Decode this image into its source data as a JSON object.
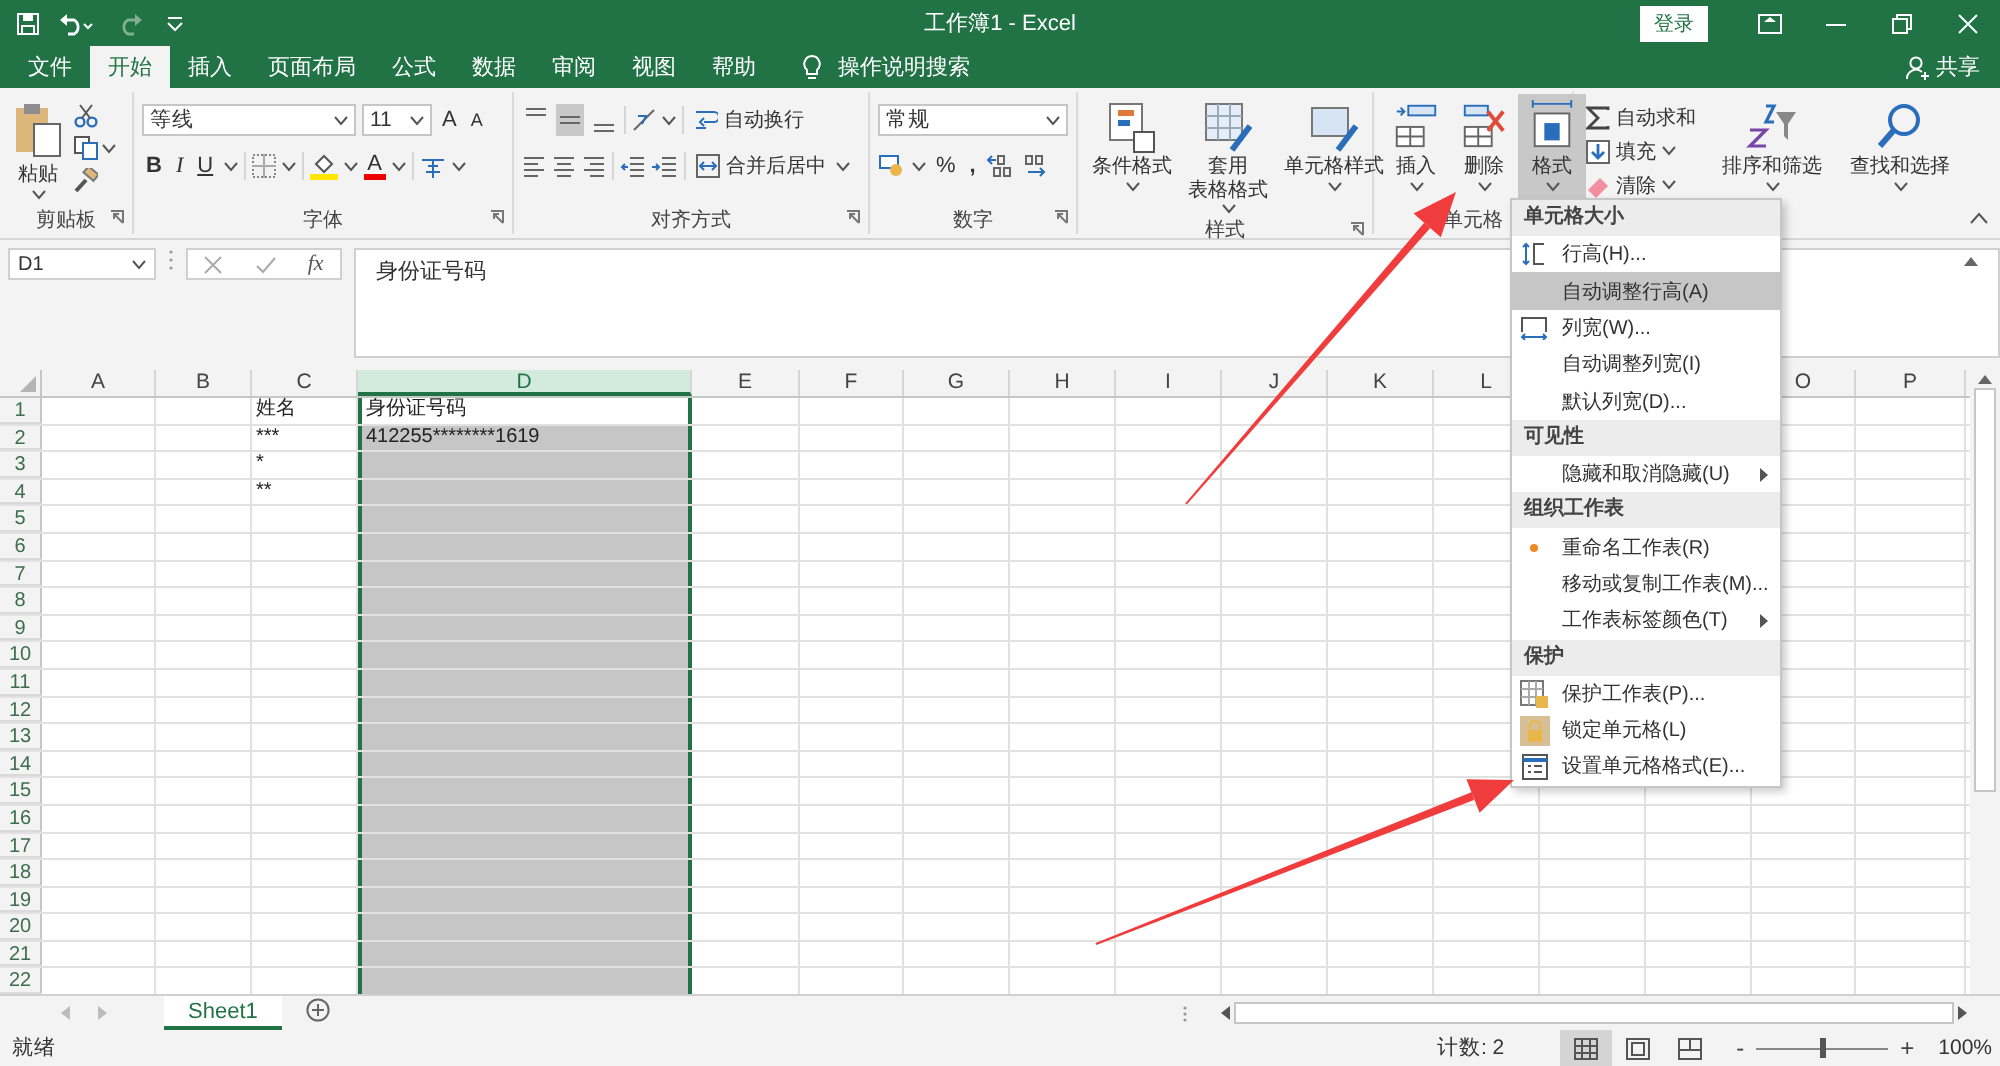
{
  "title_bar": {
    "title": "工作簿1 - Excel",
    "sign_in": "登录"
  },
  "tabs": [
    {
      "label": "文件",
      "selected": false
    },
    {
      "label": "开始",
      "selected": true
    },
    {
      "label": "插入",
      "selected": false
    },
    {
      "label": "页面布局",
      "selected": false
    },
    {
      "label": "公式",
      "selected": false
    },
    {
      "label": "数据",
      "selected": false
    },
    {
      "label": "审阅",
      "selected": false
    },
    {
      "label": "视图",
      "selected": false
    },
    {
      "label": "帮助",
      "selected": false
    }
  ],
  "tell_me": "操作说明搜索",
  "share": "共享",
  "ribbon": {
    "groups": [
      {
        "kind": "clipboard",
        "label": "剪贴板",
        "paste": "粘贴"
      },
      {
        "kind": "font",
        "label": "字体",
        "font_name": "等线",
        "font_size": "11",
        "grow": "A",
        "shrink": "A",
        "bold": "B",
        "italic": "I",
        "underline": "U",
        "font_color": "A"
      },
      {
        "kind": "alignment",
        "label": "对齐方式",
        "wrap": "自动换行",
        "merge": "合并后居中",
        "vertical": [
          {
            "selected": false
          },
          {
            "selected": true
          },
          {
            "selected": false
          }
        ]
      },
      {
        "kind": "number",
        "label": "数字",
        "format": "常规",
        "percent": "%",
        "comma": ","
      },
      {
        "kind": "styles",
        "label": "样式",
        "buttons": [
          {
            "lines": [
              "条件格式"
            ]
          },
          {
            "lines": [
              "套用",
              "表格格式"
            ]
          },
          {
            "lines": [
              "单元格样式"
            ]
          }
        ]
      },
      {
        "kind": "cells",
        "label": "单元格",
        "buttons": [
          {
            "label": "插入",
            "selected": false
          },
          {
            "label": "删除",
            "selected": false
          },
          {
            "label": "格式",
            "selected": true
          }
        ]
      },
      {
        "kind": "editing",
        "autosum": "自动求和",
        "fill": "填充",
        "clear": "清除",
        "sort": "排序和筛选",
        "find": "查找和选择"
      }
    ]
  },
  "formula_bar": {
    "name_box": "D1",
    "fx": "fx",
    "formula": "身份证号码"
  },
  "sheet": {
    "columns": [
      {
        "label": "A",
        "selected": false
      },
      {
        "label": "B",
        "selected": false
      },
      {
        "label": "C",
        "selected": false
      },
      {
        "label": "D",
        "selected": true
      },
      {
        "label": "E",
        "selected": false
      },
      {
        "label": "F",
        "selected": false
      },
      {
        "label": "G",
        "selected": false
      },
      {
        "label": "H",
        "selected": false
      },
      {
        "label": "I",
        "selected": false
      },
      {
        "label": "J",
        "selected": false
      },
      {
        "label": "K",
        "selected": false
      },
      {
        "label": "L",
        "selected": false
      },
      {
        "label": "O",
        "selected": false
      },
      {
        "label": "P",
        "selected": false
      }
    ],
    "rows": [
      {
        "label": "1",
        "column_c": "姓名",
        "column_d": "身份证号码"
      },
      {
        "label": "2",
        "column_c": "***",
        "column_d": "412255********1619"
      },
      {
        "label": "3",
        "column_c": "*"
      },
      {
        "label": "4",
        "column_c": "**"
      },
      {
        "label": "5"
      },
      {
        "label": "6"
      },
      {
        "label": "7"
      },
      {
        "label": "8"
      },
      {
        "label": "9"
      },
      {
        "label": "10"
      },
      {
        "label": "11"
      },
      {
        "label": "12"
      },
      {
        "label": "13"
      },
      {
        "label": "14"
      },
      {
        "label": "15"
      },
      {
        "label": "16"
      },
      {
        "label": "17"
      },
      {
        "label": "18"
      },
      {
        "label": "19"
      },
      {
        "label": "20"
      },
      {
        "label": "21"
      },
      {
        "label": "22"
      }
    ]
  },
  "sheet_tabs": [
    {
      "label": "Sheet1",
      "selected": true
    }
  ],
  "status_bar": {
    "status": "就绪",
    "count": "计数: 2",
    "views": [
      {
        "selected": true
      },
      {
        "selected": false
      },
      {
        "selected": false
      }
    ],
    "zoom_out": "-",
    "zoom_slider": {
      "level": 0.5
    },
    "zoom_in": "+",
    "zoom": "100%"
  },
  "context_menu": {
    "sections": [
      {
        "heading": "单元格大小",
        "items": [
          {
            "kind": "row-height",
            "label": "行高(H)...",
            "selected": false,
            "submenu": false
          },
          {
            "kind": "plain",
            "label": "自动调整行高(A)",
            "selected": true,
            "submenu": false
          },
          {
            "kind": "column-width",
            "label": "列宽(W)...",
            "selected": false,
            "submenu": false
          },
          {
            "kind": "plain",
            "label": "自动调整列宽(I)",
            "selected": false,
            "submenu": false
          },
          {
            "kind": "plain",
            "label": "默认列宽(D)...",
            "selected": false,
            "submenu": false
          }
        ]
      },
      {
        "heading": "可见性",
        "items": [
          {
            "kind": "plain",
            "label": "隐藏和取消隐藏(U)",
            "selected": false,
            "submenu": true
          }
        ]
      },
      {
        "heading": "组织工作表",
        "items": [
          {
            "kind": "bullet",
            "label": "重命名工作表(R)",
            "selected": false,
            "submenu": false
          },
          {
            "kind": "plain",
            "label": "移动或复制工作表(M)...",
            "selected": false,
            "submenu": false
          },
          {
            "kind": "plain",
            "label": "工作表标签颜色(T)",
            "selected": false,
            "submenu": true
          }
        ]
      },
      {
        "heading": "保护",
        "items": [
          {
            "kind": "protect-sheet",
            "label": "保护工作表(P)...",
            "selected": false,
            "submenu": false
          },
          {
            "kind": "lock",
            "label": "锁定单元格(L)",
            "selected": false,
            "submenu": false
          },
          {
            "kind": "format-cells",
            "label": "设置单元格格式(E)...",
            "selected": false,
            "submenu": false
          }
        ]
      }
    ]
  }
}
